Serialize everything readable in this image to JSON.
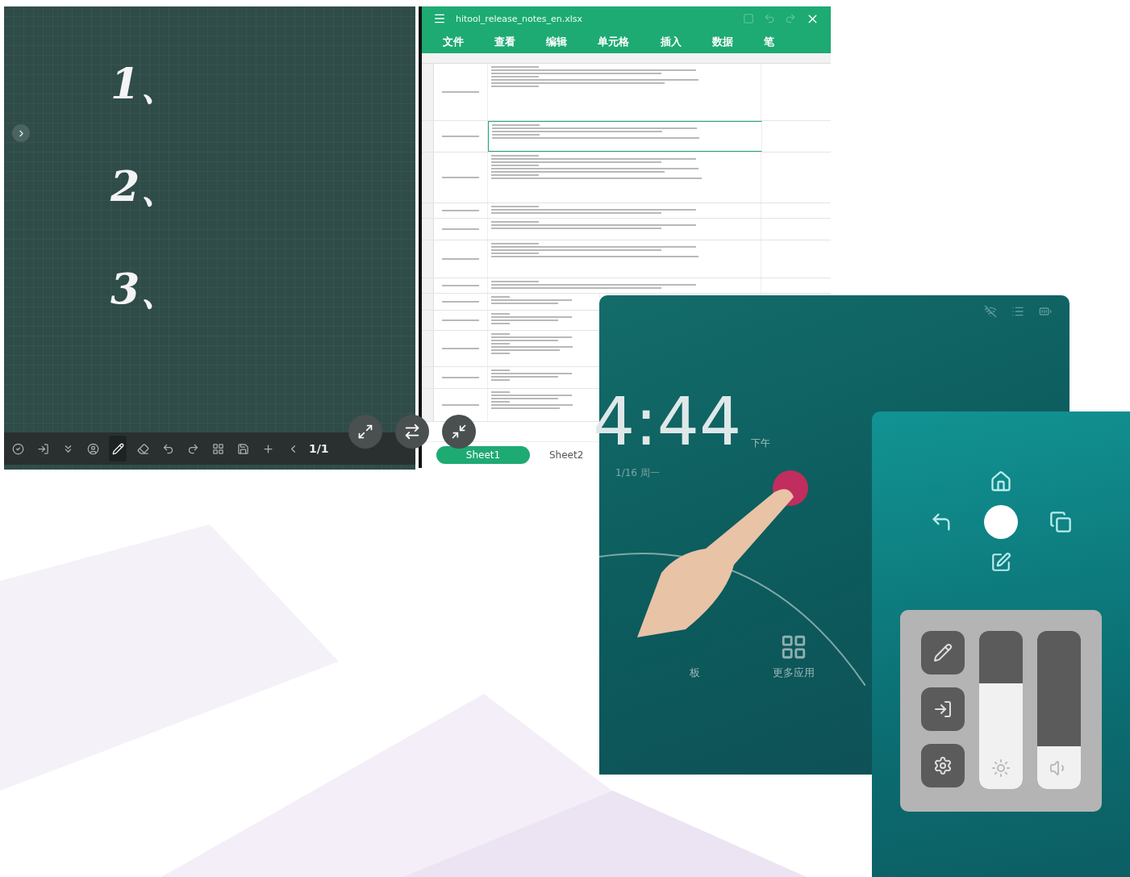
{
  "whiteboard": {
    "handwriting": [
      "1、",
      "2、",
      "3、"
    ],
    "page_counter": "1/1"
  },
  "spreadsheet": {
    "title": "hitool_release_notes_en.xlsx",
    "menu": [
      "文件",
      "查看",
      "编辑",
      "单元格",
      "插入",
      "数据",
      "笔"
    ],
    "sheets": [
      {
        "label": "Sheet1",
        "selected": true
      },
      {
        "label": "Sheet2",
        "selected": false
      }
    ]
  },
  "lock_screen": {
    "time": "4:44",
    "meridiem": "下午",
    "date": "1/16 周一",
    "apps": [
      "板",
      "更多应用"
    ]
  },
  "control_panel": {
    "sliders": [
      {
        "kind": "brightness",
        "level": 0.67
      },
      {
        "kind": "volume",
        "level": 0.27
      }
    ]
  }
}
